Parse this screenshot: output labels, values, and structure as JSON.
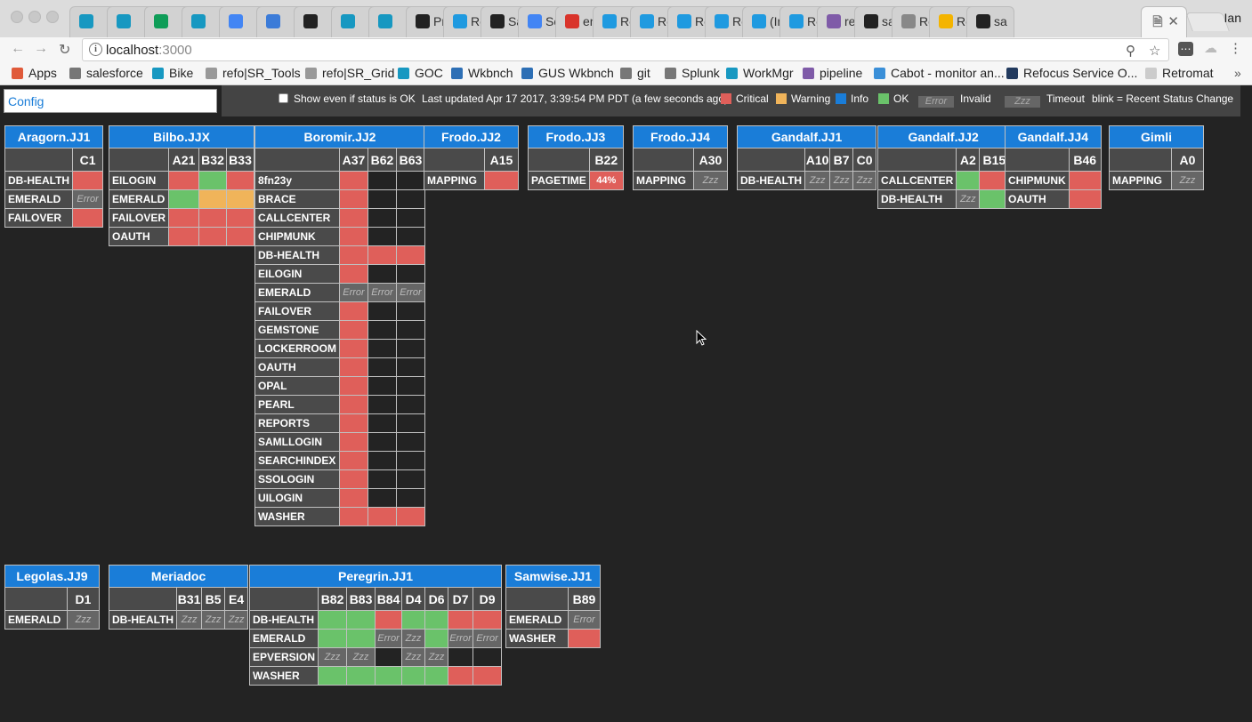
{
  "browser": {
    "tabs": [
      {
        "icon": "salesforce-cloud-icon",
        "color": "#1798c1",
        "title": ""
      },
      {
        "icon": "salesforce-cloud-icon",
        "color": "#1798c1",
        "title": ""
      },
      {
        "icon": "google-sheets-icon",
        "color": "#0f9d58",
        "title": ""
      },
      {
        "icon": "salesforce-cloud-icon",
        "color": "#1798c1",
        "title": ""
      },
      {
        "icon": "calendar-icon",
        "color": "#4285f4",
        "title": ""
      },
      {
        "icon": "mail-icon",
        "color": "#3b7bd8",
        "title": ""
      },
      {
        "icon": "github-icon",
        "color": "#222222",
        "title": ""
      },
      {
        "icon": "salesforce-cloud-icon",
        "color": "#1798c1",
        "title": ""
      },
      {
        "icon": "salesforce-cloud-icon",
        "color": "#1798c1",
        "title": ""
      },
      {
        "icon": "github-icon",
        "color": "#222222",
        "title": "Pr"
      },
      {
        "icon": "quip-icon",
        "color": "#1f9ae0",
        "title": "Re"
      },
      {
        "icon": "fc-icon",
        "color": "#222222",
        "title": "Sa"
      },
      {
        "icon": "google-docs-icon",
        "color": "#4285f4",
        "title": "Sc"
      },
      {
        "icon": "n-icon",
        "color": "#d9342b",
        "title": "en"
      },
      {
        "icon": "quip-icon",
        "color": "#1f9ae0",
        "title": "Re"
      },
      {
        "icon": "quip-icon",
        "color": "#1f9ae0",
        "title": "Re"
      },
      {
        "icon": "quip-icon",
        "color": "#1f9ae0",
        "title": "Re"
      },
      {
        "icon": "quip-icon",
        "color": "#1f9ae0",
        "title": "Re"
      },
      {
        "icon": "quip-icon",
        "color": "#1f9ae0",
        "title": "(In"
      },
      {
        "icon": "quip-icon",
        "color": "#1f9ae0",
        "title": "Re"
      },
      {
        "icon": "heroku-icon",
        "color": "#7f5ba8",
        "title": "ref"
      },
      {
        "icon": "github-icon",
        "color": "#222222",
        "title": "sal"
      },
      {
        "icon": "page-icon",
        "color": "#888888",
        "title": "Re"
      },
      {
        "icon": "slides-icon",
        "color": "#f4b400",
        "title": "Re"
      },
      {
        "icon": "github-icon",
        "color": "#222222",
        "title": "sa"
      }
    ],
    "profile": "Ian",
    "url_host": "localhost",
    "url_port": ":3000",
    "bookmarks": [
      {
        "label": "Apps",
        "icon": "apps-grid-icon",
        "color": "#e05a3a"
      },
      {
        "label": "salesforce",
        "icon": "folder-icon",
        "color": "#777777"
      },
      {
        "label": "Bike",
        "icon": "salesforce-cloud-icon",
        "color": "#1798c1"
      },
      {
        "label": "refo|SR_Tools",
        "icon": "page-icon",
        "color": "#999999"
      },
      {
        "label": "refo|SR_Grid",
        "icon": "page-icon",
        "color": "#999999"
      },
      {
        "label": "GOC",
        "icon": "salesforce-cloud-icon",
        "color": "#1798c1"
      },
      {
        "label": "Wkbnch",
        "icon": "cube-icon",
        "color": "#2d6fb5"
      },
      {
        "label": "GUS Wkbnch",
        "icon": "cube-icon",
        "color": "#2d6fb5"
      },
      {
        "label": "git",
        "icon": "folder-icon",
        "color": "#777777"
      },
      {
        "label": "Splunk",
        "icon": "folder-icon",
        "color": "#777777"
      },
      {
        "label": "WorkMgr",
        "icon": "salesforce-cloud-icon",
        "color": "#1798c1"
      },
      {
        "label": "pipeline",
        "icon": "heroku-icon",
        "color": "#7f5ba8"
      },
      {
        "label": "Cabot - monitor an...",
        "icon": "cabot-icon",
        "color": "#3a8fd8"
      },
      {
        "label": "Refocus Service O...",
        "icon": "refocus-x-icon",
        "color": "#223a5e"
      },
      {
        "label": "Retromat",
        "icon": "retromat-icon",
        "color": "#cccccc"
      }
    ],
    "more_bookmarks": "»"
  },
  "app": {
    "config_value": "Config",
    "show_ok_label": "Show even if status is OK",
    "last_updated": "Last updated Apr 17 2017, 3:39:54 PM PDT (a few seconds ago)",
    "legend": {
      "critical": {
        "label": "Critical",
        "color": "#df5f5a"
      },
      "warning": {
        "label": "Warning",
        "color": "#f0b45a"
      },
      "info": {
        "label": "Info",
        "color": "#1a7dd8"
      },
      "ok": {
        "label": "OK",
        "color": "#6ac26a"
      },
      "invalid": {
        "sample": "Error",
        "label": "Invalid"
      },
      "timeout": {
        "sample": "Zzz",
        "label": "Timeout"
      },
      "blink": "blink = Recent Status Change"
    },
    "status_text": {
      "e": "Error",
      "z": "Zzz"
    }
  },
  "panels": [
    {
      "title": "Aragorn.JJ1",
      "cols": [
        "C1"
      ],
      "rows": [
        {
          "label": "DB-HEALTH",
          "cells": [
            "c"
          ]
        },
        {
          "label": "EMERALD",
          "cells": [
            "e"
          ]
        },
        {
          "label": "FAILOVER",
          "cells": [
            "c"
          ]
        }
      ]
    },
    {
      "title": "Bilbo.JJX",
      "cols": [
        "A21",
        "B32",
        "B33"
      ],
      "rows": [
        {
          "label": "EILOGIN",
          "cells": [
            "c",
            "o",
            "c"
          ]
        },
        {
          "label": "EMERALD",
          "cells": [
            "o",
            "w",
            "w"
          ]
        },
        {
          "label": "FAILOVER",
          "cells": [
            "c",
            "c",
            "c"
          ]
        },
        {
          "label": "OAUTH",
          "cells": [
            "c",
            "c",
            "c"
          ]
        }
      ]
    },
    {
      "title": "Boromir.JJ2",
      "cols": [
        "A37",
        "B62",
        "B63"
      ],
      "rows": [
        {
          "label": "8fn23y",
          "cells": [
            "c",
            "n",
            "n"
          ]
        },
        {
          "label": "BRACE",
          "cells": [
            "c",
            "n",
            "n"
          ]
        },
        {
          "label": "CALLCENTER",
          "cells": [
            "c",
            "n",
            "n"
          ]
        },
        {
          "label": "CHIPMUNK",
          "cells": [
            "c",
            "n",
            "n"
          ]
        },
        {
          "label": "DB-HEALTH",
          "cells": [
            "c",
            "c",
            "c"
          ]
        },
        {
          "label": "EILOGIN",
          "cells": [
            "c",
            "n",
            "n"
          ]
        },
        {
          "label": "EMERALD",
          "cells": [
            "e",
            "e",
            "e"
          ]
        },
        {
          "label": "FAILOVER",
          "cells": [
            "c",
            "n",
            "n"
          ]
        },
        {
          "label": "GEMSTONE",
          "cells": [
            "c",
            "n",
            "n"
          ]
        },
        {
          "label": "LOCKERROOM",
          "cells": [
            "c",
            "n",
            "n"
          ]
        },
        {
          "label": "OAUTH",
          "cells": [
            "c",
            "n",
            "n"
          ]
        },
        {
          "label": "OPAL",
          "cells": [
            "c",
            "n",
            "n"
          ]
        },
        {
          "label": "PEARL",
          "cells": [
            "c",
            "n",
            "n"
          ]
        },
        {
          "label": "REPORTS",
          "cells": [
            "c",
            "n",
            "n"
          ]
        },
        {
          "label": "SAMLLOGIN",
          "cells": [
            "c",
            "n",
            "n"
          ]
        },
        {
          "label": "SEARCHINDEX",
          "cells": [
            "c",
            "n",
            "n"
          ]
        },
        {
          "label": "SSOLOGIN",
          "cells": [
            "c",
            "n",
            "n"
          ]
        },
        {
          "label": "UILOGIN",
          "cells": [
            "c",
            "n",
            "n"
          ]
        },
        {
          "label": "WASHER",
          "cells": [
            "c",
            "c",
            "c"
          ]
        }
      ]
    },
    {
      "title": "Frodo.JJ2",
      "cols": [
        "A15"
      ],
      "rows": [
        {
          "label": "MAPPING",
          "cells": [
            "c"
          ]
        }
      ]
    },
    {
      "title": "Frodo.JJ3",
      "cols": [
        "B22"
      ],
      "rows": [
        {
          "label": "PAGETIME",
          "cells": [
            "p:44%"
          ]
        }
      ]
    },
    {
      "title": "Frodo.JJ4",
      "cols": [
        "A30"
      ],
      "rows": [
        {
          "label": "MAPPING",
          "cells": [
            "z"
          ]
        }
      ]
    },
    {
      "title": "Gandalf.JJ1",
      "cols": [
        "A10",
        "B7",
        "C0"
      ],
      "rows": [
        {
          "label": "DB-HEALTH",
          "cells": [
            "z",
            "z",
            "z"
          ]
        }
      ]
    },
    {
      "title": "Gandalf.JJ2",
      "cols": [
        "A2",
        "B15"
      ],
      "rows": [
        {
          "label": "CALLCENTER",
          "cells": [
            "o",
            "c"
          ]
        },
        {
          "label": "DB-HEALTH",
          "cells": [
            "z",
            "o"
          ]
        }
      ]
    },
    {
      "title": "Gandalf.JJ4",
      "cols": [
        "B46"
      ],
      "rows": [
        {
          "label": "CHIPMUNK",
          "cells": [
            "c"
          ]
        },
        {
          "label": "OAUTH",
          "cells": [
            "c"
          ]
        }
      ]
    },
    {
      "title": "Gimli",
      "cols": [
        "A0"
      ],
      "rows": [
        {
          "label": "MAPPING",
          "cells": [
            "z"
          ]
        }
      ]
    },
    {
      "title": "Legolas.JJ9",
      "cols": [
        "D1"
      ],
      "rows": [
        {
          "label": "EMERALD",
          "cells": [
            "z"
          ]
        }
      ]
    },
    {
      "title": "Meriadoc",
      "cols": [
        "B31",
        "B5",
        "E4"
      ],
      "rows": [
        {
          "label": "DB-HEALTH",
          "cells": [
            "z",
            "z",
            "z"
          ]
        }
      ]
    },
    {
      "title": "Peregrin.JJ1",
      "cols": [
        "B82",
        "B83",
        "B84",
        "D4",
        "D6",
        "D7",
        "D9"
      ],
      "rows": [
        {
          "label": "DB-HEALTH",
          "cells": [
            "o",
            "o",
            "c",
            "o",
            "o",
            "c",
            "c"
          ]
        },
        {
          "label": "EMERALD",
          "cells": [
            "o",
            "o",
            "e",
            "z",
            "o",
            "e",
            "e"
          ]
        },
        {
          "label": "EPVERSION",
          "cells": [
            "z",
            "z",
            "n",
            "z",
            "z",
            "n",
            "n"
          ]
        },
        {
          "label": "WASHER",
          "cells": [
            "o",
            "o",
            "o",
            "o",
            "o",
            "c",
            "c"
          ]
        }
      ]
    },
    {
      "title": "Samwise.JJ1",
      "cols": [
        "B89"
      ],
      "rows": [
        {
          "label": "EMERALD",
          "cells": [
            "e"
          ]
        },
        {
          "label": "WASHER",
          "cells": [
            "c"
          ]
        }
      ]
    }
  ]
}
